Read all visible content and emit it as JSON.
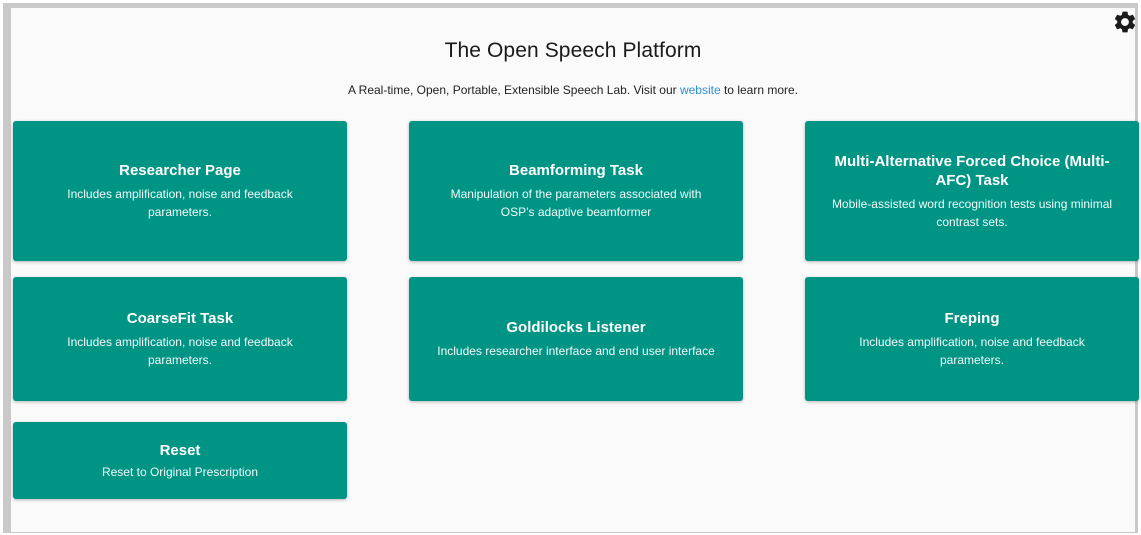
{
  "header": {
    "title": "The Open Speech Platform",
    "subtitle_before": "A Real-time, Open, Portable, Extensible Speech Lab. Visit our ",
    "subtitle_link": "website",
    "subtitle_after": " to learn more."
  },
  "icons": {
    "settings": "gear-icon"
  },
  "colors": {
    "card_background": "#009485",
    "link": "#2b8fd6",
    "page_background": "#fafafa"
  },
  "cards": [
    {
      "title": "Researcher Page",
      "description": "Includes amplification, noise and feedback parameters."
    },
    {
      "title": "Beamforming Task",
      "description": "Manipulation of the parameters associated with OSP’s adaptive beamformer"
    },
    {
      "title": "Multi-Alternative Forced Choice (Multi-AFC) Task",
      "description": "Mobile-assisted word recognition tests using minimal contrast sets."
    },
    {
      "title": "CoarseFit Task",
      "description": "Includes amplification, noise and feedback parameters."
    },
    {
      "title": "Goldilocks Listener",
      "description": "Includes researcher interface and end user interface"
    },
    {
      "title": "Freping",
      "description": "Includes amplification, noise and feedback parameters."
    },
    {
      "title": "Reset",
      "description": "Reset to Original Prescription"
    }
  ]
}
